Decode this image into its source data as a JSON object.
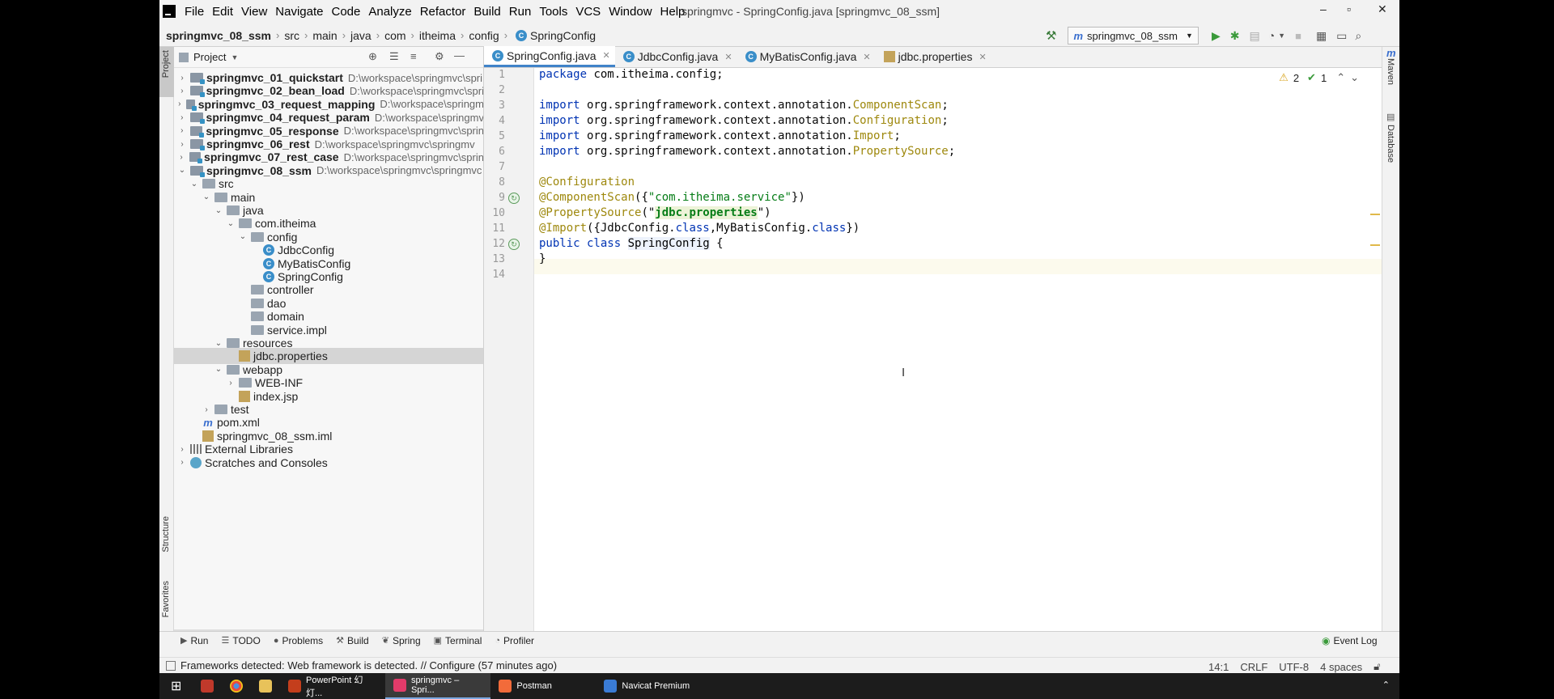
{
  "menu": [
    "File",
    "Edit",
    "View",
    "Navigate",
    "Code",
    "Analyze",
    "Refactor",
    "Build",
    "Run",
    "Tools",
    "VCS",
    "Window",
    "Help"
  ],
  "window_title": "springmvc - SpringConfig.java [springmvc_08_ssm]",
  "window_controls": {
    "minimize": "–",
    "maximize": "▫",
    "close": "✕"
  },
  "breadcrumbs": [
    "springmvc_08_ssm",
    "src",
    "main",
    "java",
    "com",
    "itheima",
    "config",
    "SpringConfig"
  ],
  "run_config": "springmvc_08_ssm",
  "project_panel": {
    "title": "Project"
  },
  "left_stripe": {
    "project": "Project",
    "structure": "Structure",
    "favorites": "Favorites"
  },
  "right_stripe": {
    "maven": "Maven",
    "database": "Database"
  },
  "tree": [
    {
      "label": "springmvc_01_quickstart",
      "path": "D:\\workspace\\springmvc\\spri",
      "level": 0,
      "arrow": "›",
      "icon": "module",
      "bold": true
    },
    {
      "label": "springmvc_02_bean_load",
      "path": "D:\\workspace\\springmvc\\spri",
      "level": 0,
      "arrow": "›",
      "icon": "module",
      "bold": true
    },
    {
      "label": "springmvc_03_request_mapping",
      "path": "D:\\workspace\\springm",
      "level": 0,
      "arrow": "›",
      "icon": "module",
      "bold": true
    },
    {
      "label": "springmvc_04_request_param",
      "path": "D:\\workspace\\springmv",
      "level": 0,
      "arrow": "›",
      "icon": "module",
      "bold": true
    },
    {
      "label": "springmvc_05_response",
      "path": "D:\\workspace\\springmvc\\sprin",
      "level": 0,
      "arrow": "›",
      "icon": "module",
      "bold": true
    },
    {
      "label": "springmvc_06_rest",
      "path": "D:\\workspace\\springmvc\\springmv",
      "level": 0,
      "arrow": "›",
      "icon": "module",
      "bold": true
    },
    {
      "label": "springmvc_07_rest_case",
      "path": "D:\\workspace\\springmvc\\sprin",
      "level": 0,
      "arrow": "›",
      "icon": "module",
      "bold": true
    },
    {
      "label": "springmvc_08_ssm",
      "path": "D:\\workspace\\springmvc\\springmvc",
      "level": 0,
      "arrow": "⌄",
      "icon": "module",
      "bold": true
    },
    {
      "label": "src",
      "path": "",
      "level": 1,
      "arrow": "⌄",
      "icon": "folder",
      "bold": false
    },
    {
      "label": "main",
      "path": "",
      "level": 2,
      "arrow": "⌄",
      "icon": "folder",
      "bold": false
    },
    {
      "label": "java",
      "path": "",
      "level": 3,
      "arrow": "⌄",
      "icon": "folder",
      "bold": false
    },
    {
      "label": "com.itheima",
      "path": "",
      "level": 4,
      "arrow": "⌄",
      "icon": "folder",
      "bold": false
    },
    {
      "label": "config",
      "path": "",
      "level": 5,
      "arrow": "⌄",
      "icon": "folder",
      "bold": false
    },
    {
      "label": "JdbcConfig",
      "path": "",
      "level": 6,
      "arrow": "",
      "icon": "class",
      "bold": false
    },
    {
      "label": "MyBatisConfig",
      "path": "",
      "level": 6,
      "arrow": "",
      "icon": "class",
      "bold": false
    },
    {
      "label": "SpringConfig",
      "path": "",
      "level": 6,
      "arrow": "",
      "icon": "class",
      "bold": false
    },
    {
      "label": "controller",
      "path": "",
      "level": 5,
      "arrow": "",
      "icon": "folder",
      "bold": false
    },
    {
      "label": "dao",
      "path": "",
      "level": 5,
      "arrow": "",
      "icon": "folder",
      "bold": false
    },
    {
      "label": "domain",
      "path": "",
      "level": 5,
      "arrow": "",
      "icon": "folder",
      "bold": false
    },
    {
      "label": "service.impl",
      "path": "",
      "level": 5,
      "arrow": "",
      "icon": "folder",
      "bold": false
    },
    {
      "label": "resources",
      "path": "",
      "level": 3,
      "arrow": "⌄",
      "icon": "folder",
      "bold": false
    },
    {
      "label": "jdbc.properties",
      "path": "",
      "level": 4,
      "arrow": "",
      "icon": "file",
      "bold": false,
      "selected": true
    },
    {
      "label": "webapp",
      "path": "",
      "level": 3,
      "arrow": "⌄",
      "icon": "folder",
      "bold": false
    },
    {
      "label": "WEB-INF",
      "path": "",
      "level": 4,
      "arrow": "›",
      "icon": "folder",
      "bold": false
    },
    {
      "label": "index.jsp",
      "path": "",
      "level": 4,
      "arrow": "",
      "icon": "file",
      "bold": false
    },
    {
      "label": "test",
      "path": "",
      "level": 2,
      "arrow": "›",
      "icon": "folder",
      "bold": false
    },
    {
      "label": "pom.xml",
      "path": "",
      "level": 1,
      "arrow": "",
      "icon": "maven",
      "bold": false
    },
    {
      "label": "springmvc_08_ssm.iml",
      "path": "",
      "level": 1,
      "arrow": "",
      "icon": "file",
      "bold": false
    },
    {
      "label": "External Libraries",
      "path": "",
      "level": 0,
      "arrow": "›",
      "icon": "library",
      "bold": false
    },
    {
      "label": "Scratches and Consoles",
      "path": "",
      "level": 0,
      "arrow": "›",
      "icon": "scratch",
      "bold": false
    }
  ],
  "tabs": [
    {
      "label": "SpringConfig.java",
      "icon": "class",
      "active": true
    },
    {
      "label": "JdbcConfig.java",
      "icon": "class",
      "active": false
    },
    {
      "label": "MyBatisConfig.java",
      "icon": "class",
      "active": false
    },
    {
      "label": "jdbc.properties",
      "icon": "file",
      "active": false
    }
  ],
  "inspections": {
    "warnings": "2",
    "checks": "1"
  },
  "code_lines": [
    "package com.itheima.config;",
    "",
    "import org.springframework.context.annotation.ComponentScan;",
    "import org.springframework.context.annotation.Configuration;",
    "import org.springframework.context.annotation.Import;",
    "import org.springframework.context.annotation.PropertySource;",
    "",
    "@Configuration",
    "@ComponentScan({\"com.itheima.service\"})",
    "@PropertySource(\"jdbc.properties\")",
    "@Import({JdbcConfig.class,MyBatisConfig.class})",
    "public class SpringConfig {",
    "}",
    ""
  ],
  "bottom_tools": [
    {
      "label": "Run",
      "icon": "▶"
    },
    {
      "label": "TODO",
      "icon": "☰"
    },
    {
      "label": "Problems",
      "icon": "●"
    },
    {
      "label": "Build",
      "icon": "⚒"
    },
    {
      "label": "Spring",
      "icon": "❦"
    },
    {
      "label": "Terminal",
      "icon": "▣"
    },
    {
      "label": "Profiler",
      "icon": "◔"
    }
  ],
  "event_log": "Event Log",
  "status_message": "Frameworks detected: Web framework is detected. // Configure (57 minutes ago)",
  "status_right": {
    "position": "14:1",
    "line_sep": "CRLF",
    "encoding": "UTF-8",
    "indent": "4 spaces"
  },
  "taskbar": [
    {
      "label": "PowerPoint 幻灯...",
      "color": "#c43e1c",
      "active": false
    },
    {
      "label": "springmvc – Spri...",
      "color": "#e23b6a",
      "active": true
    },
    {
      "label": "Postman",
      "color": "#f26b3a",
      "active": false
    },
    {
      "label": "Navicat Premium",
      "color": "#3a7bd5",
      "active": false
    }
  ]
}
